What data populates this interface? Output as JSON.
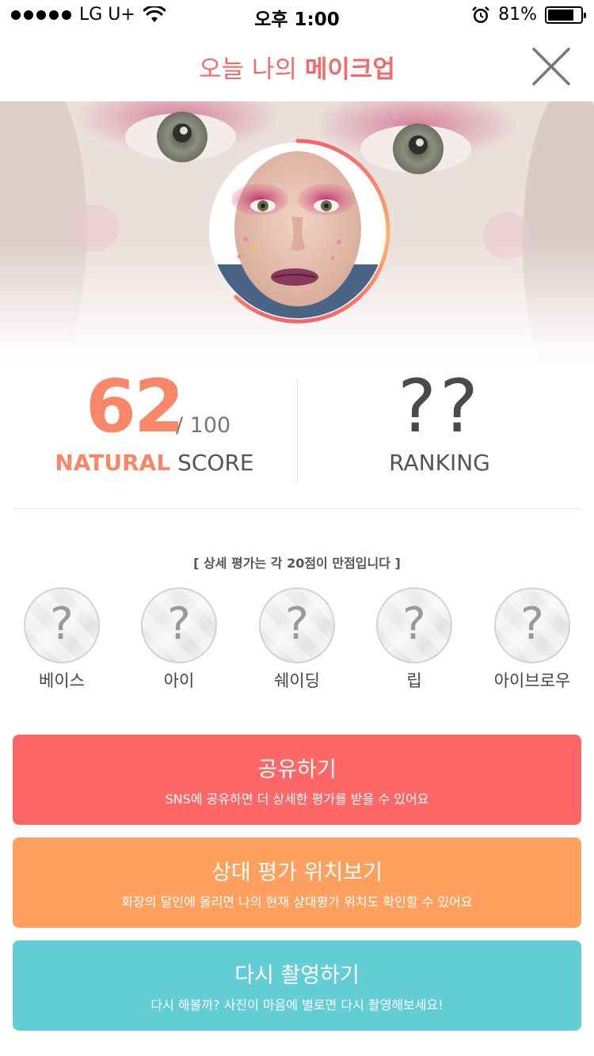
{
  "status_bar": {
    "carrier": "LG U+",
    "time": "오후 1:00",
    "battery_percent": "81%",
    "battery_level": 0.81,
    "icons": [
      "signal-dots-icon",
      "wifi-icon",
      "alarm-icon",
      "battery-icon"
    ]
  },
  "header": {
    "title_prefix": "오늘 나의 ",
    "title_accent": "메이크업",
    "close_icon": "close-icon",
    "accent_color": "#f26a6a"
  },
  "scores": {
    "natural_score": "62",
    "natural_max": "/ 100",
    "natural_label_accent": "NATURAL",
    "natural_label_rest": " SCORE",
    "ranking_value": "??",
    "ranking_label": "RANKING",
    "score_fraction": 0.62,
    "accent_color": "#f8876a"
  },
  "detail": {
    "note": "[  상세 평가는 각 20점이 만점입니다  ]",
    "categories": [
      {
        "label": "베이스",
        "value": "?"
      },
      {
        "label": "아이",
        "value": "?"
      },
      {
        "label": "쉐이딩",
        "value": "?"
      },
      {
        "label": "립",
        "value": "?"
      },
      {
        "label": "아이브로우",
        "value": "?"
      }
    ]
  },
  "buttons": {
    "share": {
      "title": "공유하기",
      "subtitle": "SNS에 공유하면 더 상세한 평가를 받을 수 있어요",
      "color": "#ff6666"
    },
    "rank": {
      "title": "상대 평가 위치보기",
      "subtitle": "화장의 달인에 올리면 나의 현재 상대평가 위치도 확인할 수 있어요",
      "color": "#ffa05f"
    },
    "retake": {
      "title": "다시 촬영하기",
      "subtitle": "다시 해볼까? 사진이 마음에 별로면 다시 촬영해보세요!",
      "color": "#62cdd4"
    }
  }
}
